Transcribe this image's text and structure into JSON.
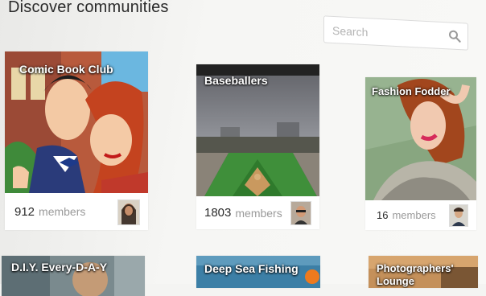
{
  "header": {
    "title": "Discover communities"
  },
  "search": {
    "placeholder": "Search"
  },
  "communities": [
    {
      "name": "Comic Book Club",
      "count": "912",
      "members_label": "members"
    },
    {
      "name": "Baseballers",
      "count": "1803",
      "members_label": "members"
    },
    {
      "name": "Fashion Fodder",
      "count": "16",
      "members_label": "members"
    },
    {
      "name": "D.I.Y. Every-D-A-Y",
      "count": "",
      "members_label": ""
    },
    {
      "name": "Deep Sea Fishing",
      "count": "",
      "members_label": ""
    },
    {
      "name": "Photographers' Lounge",
      "count": "",
      "members_label": ""
    }
  ],
  "icons": {
    "search": "search-icon"
  },
  "colors": {
    "background": "#f4f4f2",
    "card": "#ffffff",
    "count_text": "#2b2b2b",
    "members_text": "#9a9a9a"
  }
}
